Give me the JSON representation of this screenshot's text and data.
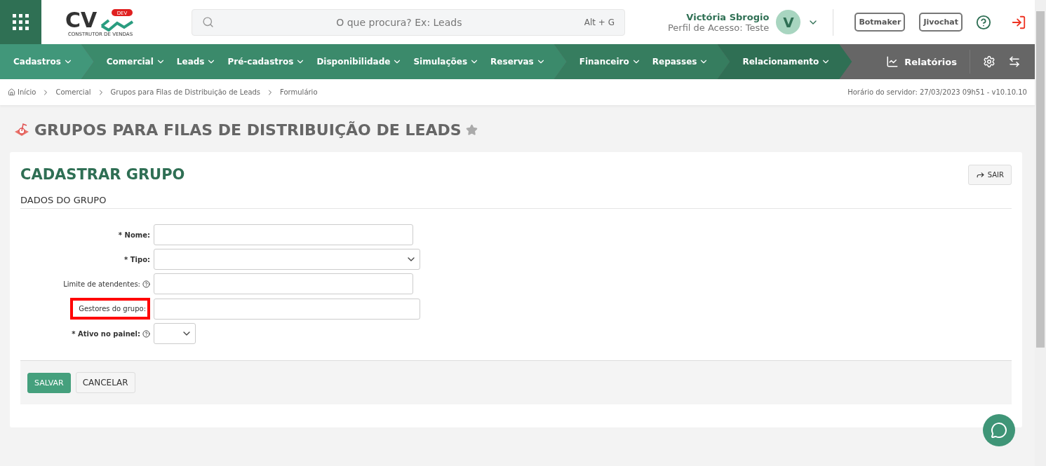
{
  "header": {
    "logo_text": "CV",
    "logo_badge": "DEV",
    "logo_tagline": "CONSTRUTOR DE VENDAS",
    "search": {
      "placeholder": "O que procura? Ex: Leads",
      "shortcut": "Alt + G"
    },
    "user": {
      "name": "Victória Sbrogio",
      "profile": "Perfil de Acesso: Teste",
      "initial": "V"
    },
    "buttons": [
      "Botmaker",
      "Jivochat"
    ]
  },
  "nav": {
    "groups": [
      {
        "color": "#41977a",
        "items": [
          "Cadastros"
        ]
      },
      {
        "color": "#3b8a6b",
        "items": [
          "Comercial",
          "Leads",
          "Pré-cadastros",
          "Disponibilidade",
          "Simulações",
          "Reservas"
        ]
      },
      {
        "color": "#367d5f",
        "items": [
          "Financeiro",
          "Repasses"
        ]
      },
      {
        "color": "#2f6f54",
        "items": [
          "Relacionamento"
        ]
      }
    ],
    "reports": "Relatórios"
  },
  "breadcrumb": {
    "items": [
      "Início",
      "Comercial",
      "Grupos para Filas de Distribuição de Leads",
      "Formulário"
    ],
    "server_info": "Horário do servidor: 27/03/2023 09h51 - v10.10.10"
  },
  "page_title": "GRUPOS PARA FILAS DE DISTRIBUIÇÃO DE LEADS",
  "favorite": false,
  "form": {
    "title": "CADASTRAR GRUPO",
    "exit_button": "SAIR",
    "section": "DADOS DO GRUPO",
    "fields": [
      {
        "label": "Nome:",
        "kind": "text",
        "required": true,
        "help": false,
        "highlighted": false
      },
      {
        "label": "Tipo:",
        "kind": "select",
        "required": true,
        "help": false,
        "highlighted": false
      },
      {
        "label": "Limite de atendentes:",
        "kind": "text",
        "required": false,
        "help": true,
        "highlighted": false
      },
      {
        "label": "Gestores do grupo:",
        "kind": "multi",
        "required": false,
        "help": false,
        "highlighted": true
      },
      {
        "label": "Ativo no painel:",
        "kind": "select-small",
        "required": true,
        "help": true,
        "highlighted": false
      }
    ],
    "required_mark": "*",
    "actions": [
      {
        "label": "SALVAR",
        "kind": "primary"
      },
      {
        "label": "CANCELAR",
        "kind": "secondary"
      }
    ]
  }
}
